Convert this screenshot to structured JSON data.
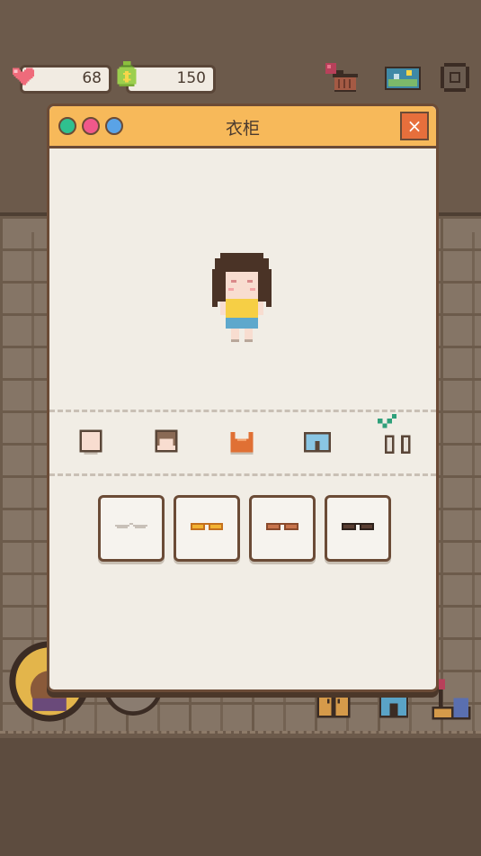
{
  "hud": {
    "health_value": "68",
    "money_value": "150"
  },
  "modal": {
    "title": "衣柜",
    "close_symbol": "×"
  },
  "categories": [
    {
      "name": "face"
    },
    {
      "name": "hair"
    },
    {
      "name": "top"
    },
    {
      "name": "bottom"
    },
    {
      "name": "shoes",
      "selected": true
    }
  ],
  "items": [
    {
      "name": "none"
    },
    {
      "name": "orange-glasses"
    },
    {
      "name": "brown-glasses"
    },
    {
      "name": "black-glasses"
    }
  ],
  "colors": {
    "header": "#f7b95a",
    "close": "#e76f3c",
    "dot_green": "#2fc08f",
    "dot_pink": "#f0588a",
    "dot_blue": "#5aa3e6"
  }
}
